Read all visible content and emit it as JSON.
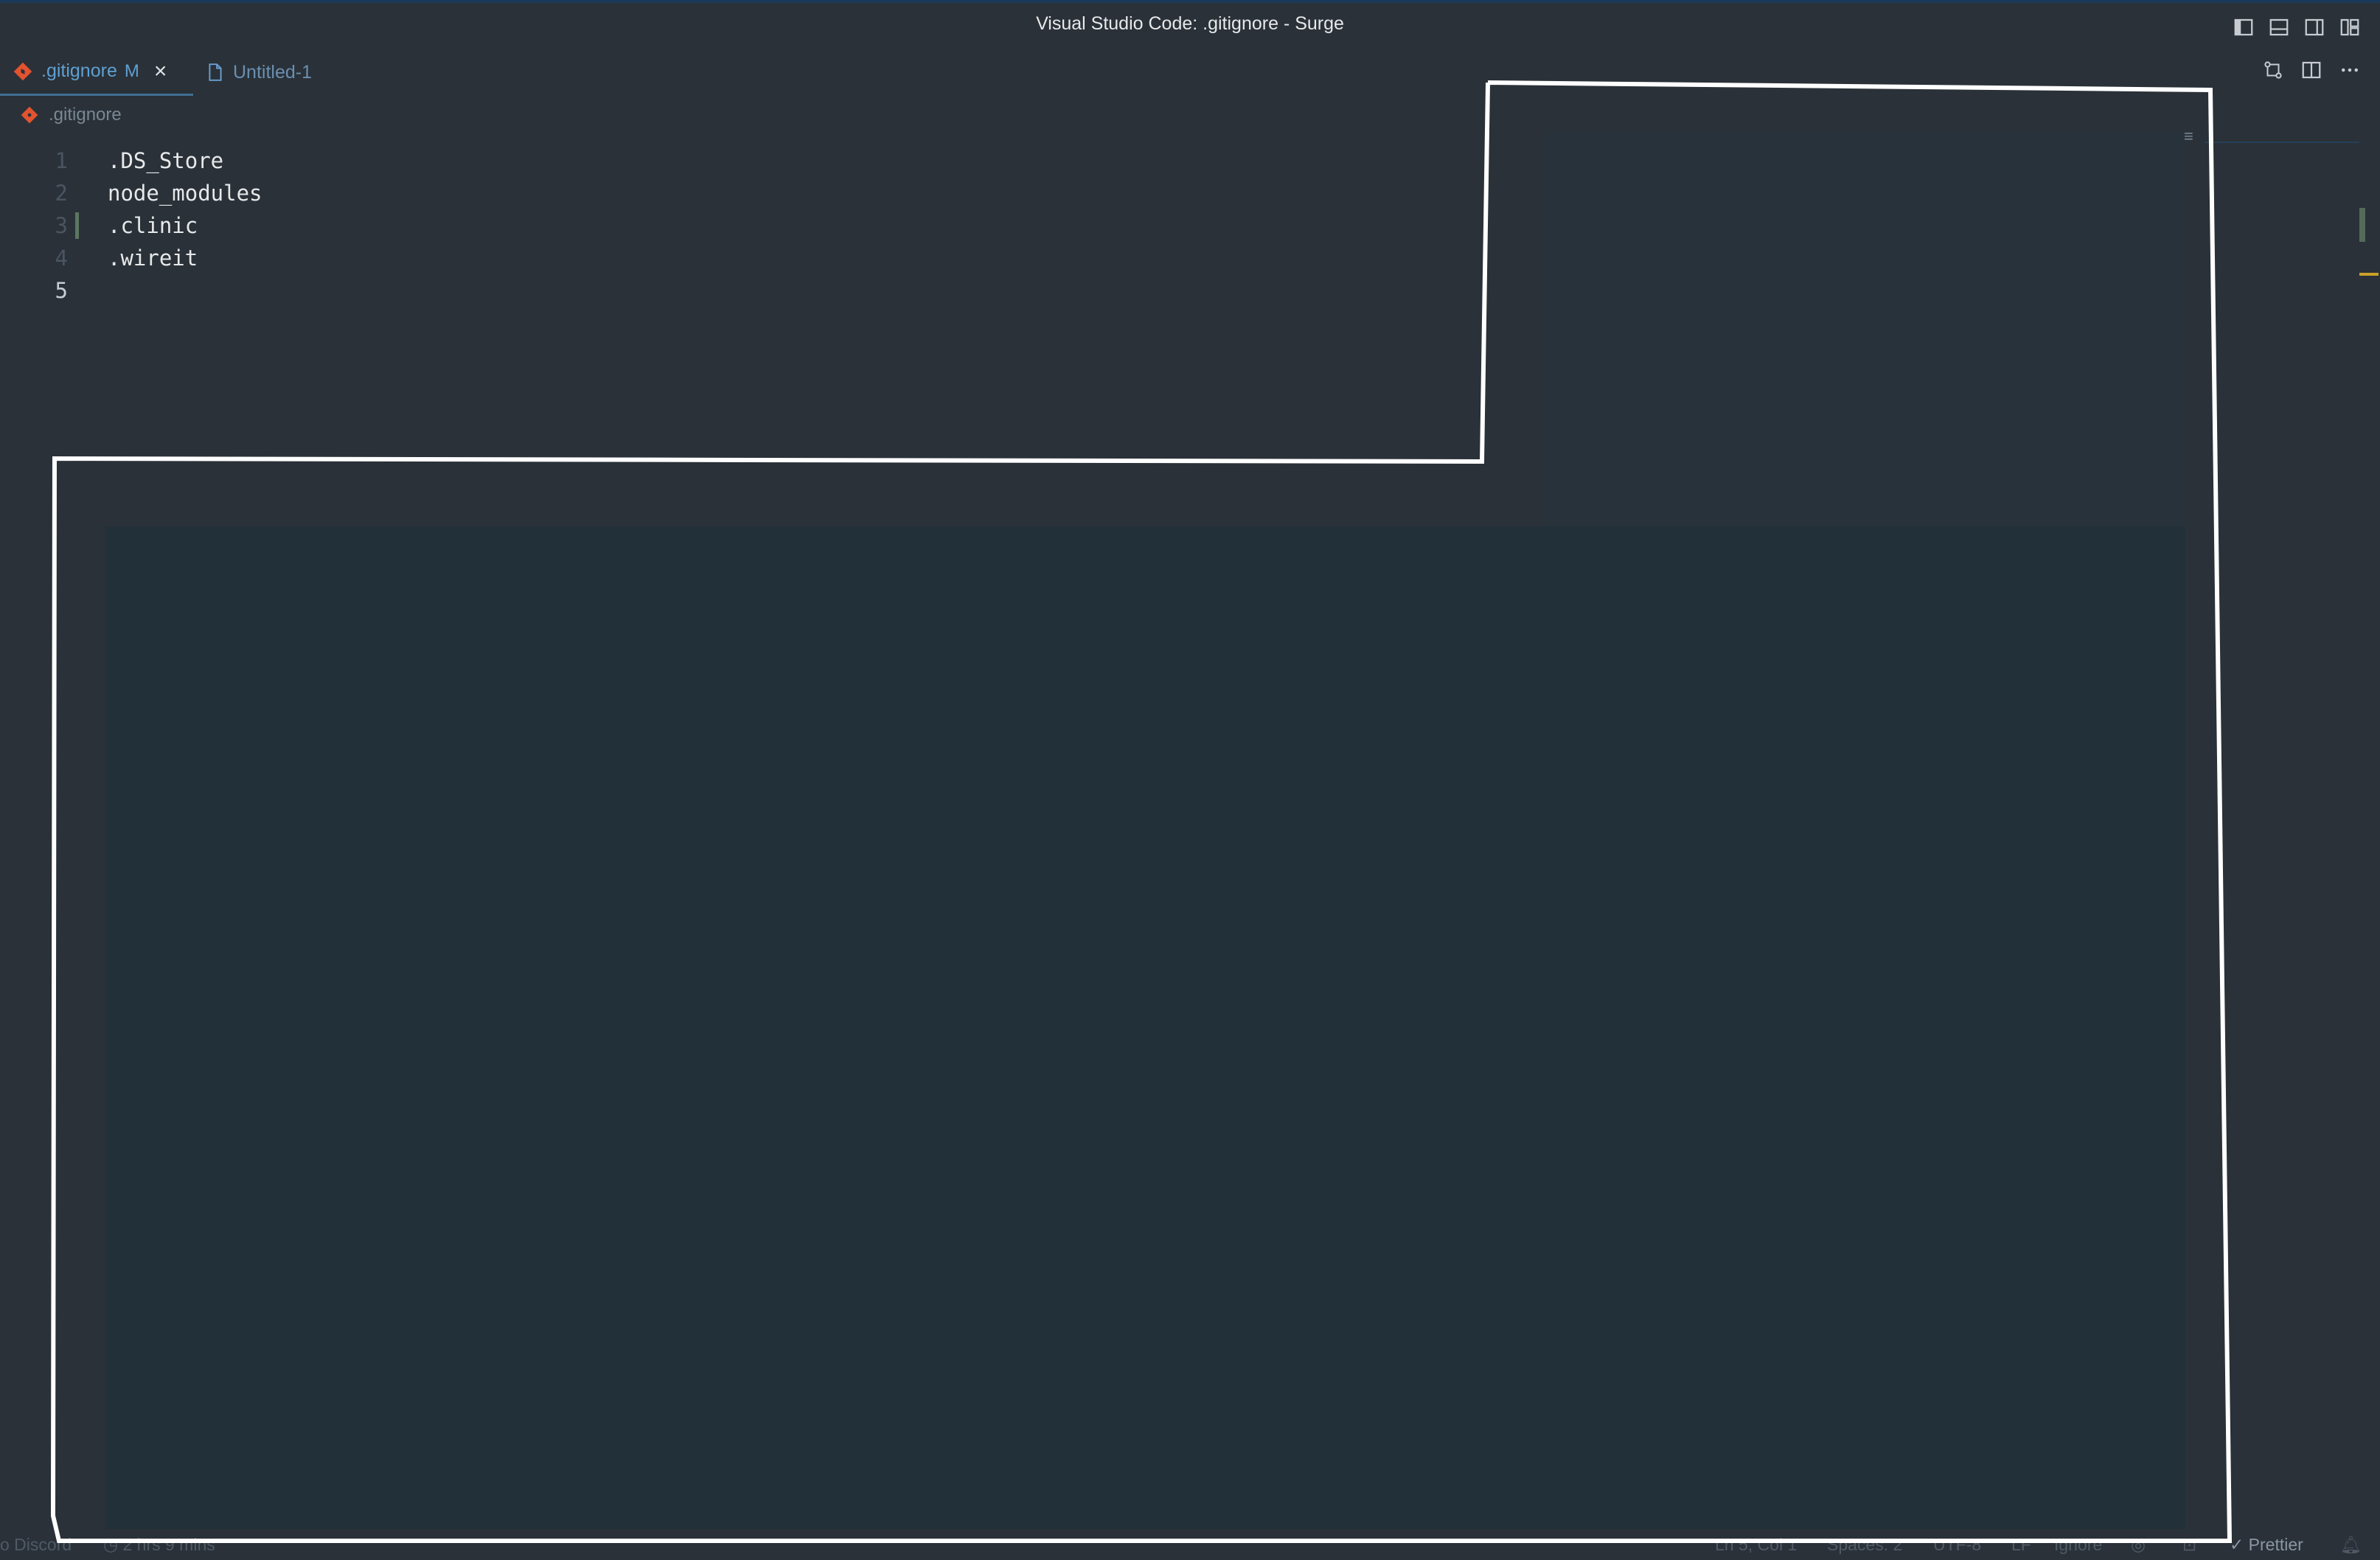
{
  "window": {
    "title": "Visual Studio Code: .gitignore - Surge"
  },
  "tabs": [
    {
      "label": ".gitignore",
      "status": "M",
      "icon": "git-file-icon",
      "active": true
    },
    {
      "label": "Untitled-1",
      "icon": "file-icon",
      "active": false
    }
  ],
  "breadcrumb": {
    "label": ".gitignore"
  },
  "editor": {
    "lines": [
      {
        "number": "1",
        "text": ".DS_Store"
      },
      {
        "number": "2",
        "text": "node_modules"
      },
      {
        "number": "3",
        "text": ".clinic"
      },
      {
        "number": "4",
        "text": ".wireit"
      },
      {
        "number": "5",
        "text": ""
      }
    ]
  },
  "statusbar": {
    "discord": "o Discord",
    "timer": "2 hrs 9 mins",
    "position": "Ln 5, Col 1",
    "spaces": "Spaces: 2",
    "encoding": "UTF-8",
    "eol": "LF",
    "language": "Ignore",
    "prettier": "Prettier"
  },
  "colors": {
    "background": "#2a3138",
    "accent": "#5fa0d2",
    "git_icon": "#e2532f",
    "annotation": "#ffffff"
  }
}
